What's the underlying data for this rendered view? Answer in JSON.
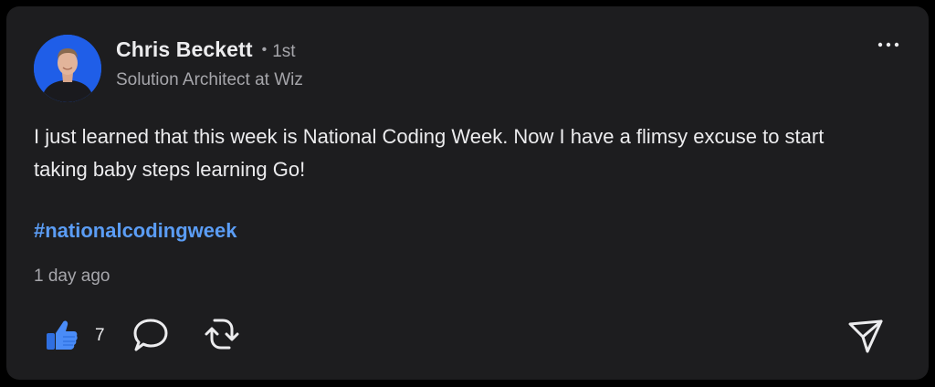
{
  "post": {
    "author": {
      "name": "Chris Beckett",
      "separator": "•",
      "degree": "1st",
      "headline": "Solution Architect at Wiz"
    },
    "body": "I just learned that this week is National Coding Week. Now I have a flimsy excuse to start taking baby steps learning Go!",
    "hashtag": "#nationalcodingweek",
    "timestamp": "1 day ago",
    "reactions": {
      "like_count": "7"
    }
  },
  "icons": {
    "avatar": "profile-photo",
    "more": "more-horizontal-icon",
    "like": "thumbs-up-icon",
    "comment": "comment-bubble-icon",
    "repost": "repost-icon",
    "send": "send-icon"
  },
  "colors": {
    "background": "#000000",
    "card": "#1d1d1f",
    "text_primary": "#ececee",
    "text_secondary": "#a6a6ab",
    "hashtag": "#5b9df5",
    "like_blue": "#3b82f6",
    "avatar_bg": "#1f5ee8"
  }
}
